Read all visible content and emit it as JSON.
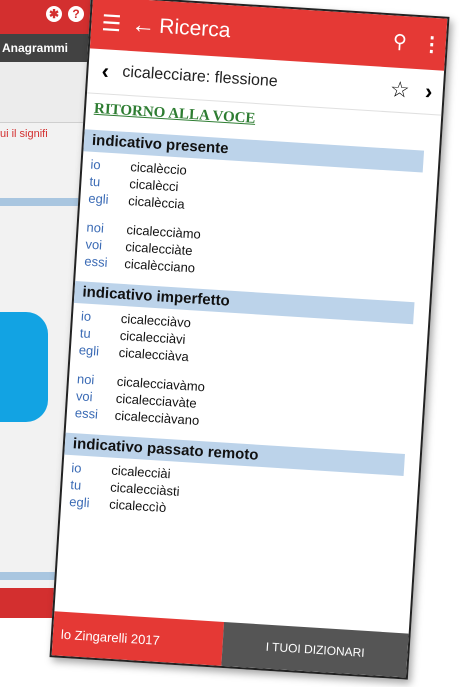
{
  "background_screen": {
    "tab_label": "Anagrammi",
    "red_text": "ui il signifi",
    "icons": [
      "gear-icon",
      "help-icon"
    ]
  },
  "appbar": {
    "title": "Ricerca",
    "icons": [
      "menu-icon",
      "back-arrow-icon",
      "search-icon",
      "more-icon"
    ]
  },
  "subheader": {
    "title": "cicalecciare: flessione",
    "icons": [
      "back-icon",
      "star-icon",
      "chevron-right-icon"
    ]
  },
  "return_link": "RITORNO ALLA VOCE",
  "sections": [
    {
      "title": "indicativo presente",
      "groups": [
        [
          {
            "p": "io",
            "f": "cicalèccio"
          },
          {
            "p": "tu",
            "f": "cicalècci"
          },
          {
            "p": "egli",
            "f": "cicalèccia"
          }
        ],
        [
          {
            "p": "noi",
            "f": "cicalecciàmo"
          },
          {
            "p": "voi",
            "f": "cicalecciàte"
          },
          {
            "p": "essi",
            "f": "cicalècciano"
          }
        ]
      ]
    },
    {
      "title": "indicativo imperfetto",
      "groups": [
        [
          {
            "p": "io",
            "f": "cicalecciàvo"
          },
          {
            "p": "tu",
            "f": "cicalecciàvi"
          },
          {
            "p": "egli",
            "f": "cicalecciàva"
          }
        ],
        [
          {
            "p": "noi",
            "f": "cicalecciavàmo"
          },
          {
            "p": "voi",
            "f": "cicalecciavàte"
          },
          {
            "p": "essi",
            "f": "cicalecciàvano"
          }
        ]
      ]
    },
    {
      "title": "indicativo passato remoto",
      "groups": [
        [
          {
            "p": "io",
            "f": "cicalecciài"
          },
          {
            "p": "tu",
            "f": "cicalecciàsti"
          },
          {
            "p": "egli",
            "f": "cicaleccìò"
          }
        ]
      ]
    }
  ],
  "bottombar": {
    "brand": "lo Zingarelli 2017",
    "dictionaries_button": "I TUOI DIZIONARI"
  },
  "colors": {
    "primary_red": "#e53935",
    "section_header": "#bcd3ea",
    "link_green": "#2e7d32",
    "pronoun_blue": "#3b6bb5",
    "bottom_dark": "#555555"
  }
}
